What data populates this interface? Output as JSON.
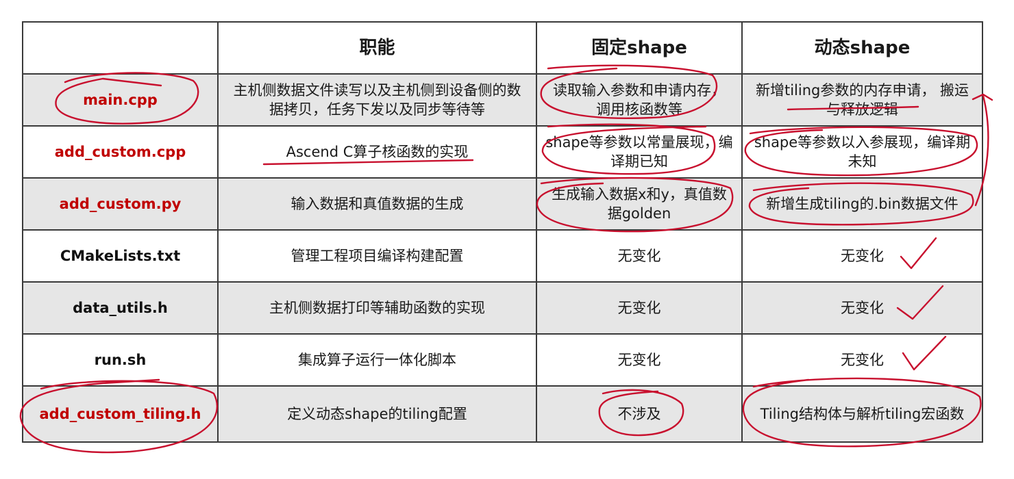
{
  "header": {
    "c1": "",
    "c2": "职能",
    "c3": "固定shape",
    "c4": "动态shape"
  },
  "rows": [
    {
      "file": "main.cpp",
      "role": "主机侧数据文件读写以及主机侧到设备侧的数据拷贝，任务下发以及同步等待等",
      "fixed": "读取输入参数和申请内存，调用核函数等",
      "dynamic": "新增tiling参数的内存申请， 搬运与释放逻辑"
    },
    {
      "file": "add_custom.cpp",
      "role": "Ascend C算子核函数的实现",
      "fixed": "shape等参数以常量展现，编译期已知",
      "dynamic": "shape等参数以入参展现，编译期未知"
    },
    {
      "file": "add_custom.py",
      "role": "输入数据和真值数据的生成",
      "fixed": "生成输入数据x和y，真值数据golden",
      "dynamic": "新增生成tiling的.bin数据文件"
    },
    {
      "file": "CMakeLists.txt",
      "role": "管理工程项目编译构建配置",
      "fixed": "无变化",
      "dynamic": "无变化"
    },
    {
      "file": "data_utils.h",
      "role": "主机侧数据打印等辅助函数的实现",
      "fixed": "无变化",
      "dynamic": "无变化"
    },
    {
      "file": "run.sh",
      "role": "集成算子运行一体化脚本",
      "fixed": "无变化",
      "dynamic": "无变化"
    },
    {
      "file": "add_custom_tiling.h",
      "role": "定义动态shape的tiling配置",
      "fixed": "不涉及",
      "dynamic": "Tiling结构体与解析tiling宏函数"
    }
  ],
  "colors": {
    "highlight_file": "#c00000",
    "annotation_ink": "#c8102e",
    "shaded_row": "#e6e6e6"
  }
}
